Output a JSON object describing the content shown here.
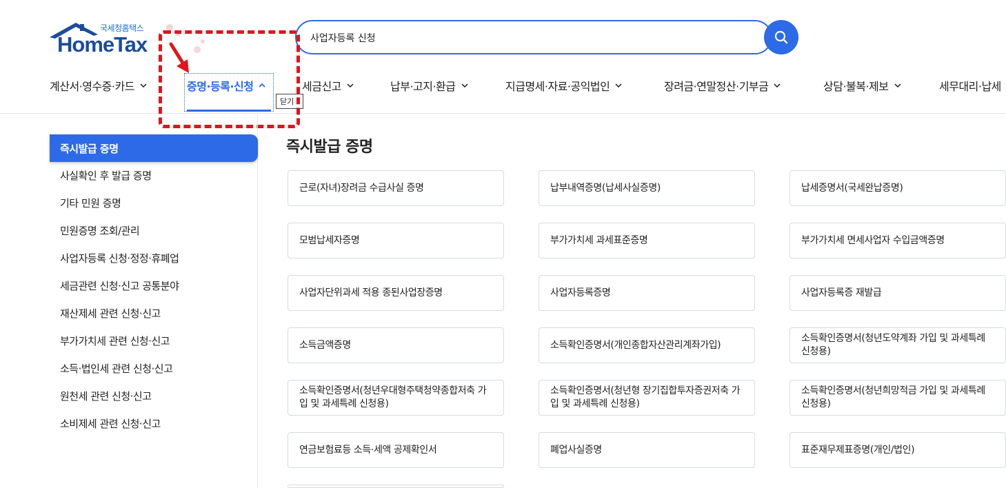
{
  "logo": {
    "sub": "국세청홈택스",
    "main": "HomeTax"
  },
  "search": {
    "value": "사업자등록 신청"
  },
  "gnb": [
    {
      "label": "계산서·영수증·카드"
    },
    {
      "label": "증명·등록·신청"
    },
    {
      "label": "세금신고"
    },
    {
      "label": "납부·고지·환급"
    },
    {
      "label": "지급명세·자료·공익법인"
    },
    {
      "label": "장려금·연말정산·기부금"
    },
    {
      "label": "상담·불복·제보"
    },
    {
      "label": "세무대리·납세"
    }
  ],
  "tooltip": {
    "close": "닫기"
  },
  "sidebar": [
    {
      "label": "즉시발급 증명"
    },
    {
      "label": "사실확인 후 발급 증명"
    },
    {
      "label": "기타 민원 증명"
    },
    {
      "label": "민원증명 조회/관리"
    },
    {
      "label": "사업자등록 신청·정정·휴폐업"
    },
    {
      "label": "세금관련 신청·신고 공통분야"
    },
    {
      "label": "재산제세 관련 신청·신고"
    },
    {
      "label": "부가가치세 관련 신청·신고"
    },
    {
      "label": "소득·법인세 관련 신청·신고"
    },
    {
      "label": "원천세 관련 신청·신고"
    },
    {
      "label": "소비제세 관련 신청·신고"
    }
  ],
  "main": {
    "title": "즉시발급 증명",
    "cards": [
      {
        "label": "근로(자녀)장려금 수급사실 증명"
      },
      {
        "label": "납부내역증명(납세사실증명)"
      },
      {
        "label": "납세증명서(국세완납증명)"
      },
      {
        "label": "모범납세자증명"
      },
      {
        "label": "부가가치세 과세표준증명"
      },
      {
        "label": "부가가치세 면세사업자 수입금액증명"
      },
      {
        "label": "사업자단위과세 적용 종된사업장증명"
      },
      {
        "label": "사업자등록증명"
      },
      {
        "label": "사업자등록증 재발급"
      },
      {
        "label": "소득금액증명"
      },
      {
        "label": "소득확인증명서(개인종합자산관리계좌가입)"
      },
      {
        "label": "소득확인증명서(청년도약계좌 가입 및 과세특례 신청용)"
      },
      {
        "label": "소득확인증명서(청년우대형주택청약종합저축 가입 및 과세특례 신청용)"
      },
      {
        "label": "소득확인증명서(청년형 장기집합투자증권저축 가입 및 과세특례 신청용)"
      },
      {
        "label": "소득확인증명서(청년희망적금 가입 및 과세특례 신청용)"
      },
      {
        "label": "연금보험료등 소득·세액 공제확인서"
      },
      {
        "label": "폐업사실증명"
      },
      {
        "label": "표준재무제표증명(개인/법인)"
      }
    ]
  },
  "colors": {
    "accent": "#2c6ae8",
    "annotation": "#e0141e",
    "logo": "#1c4c9c"
  }
}
